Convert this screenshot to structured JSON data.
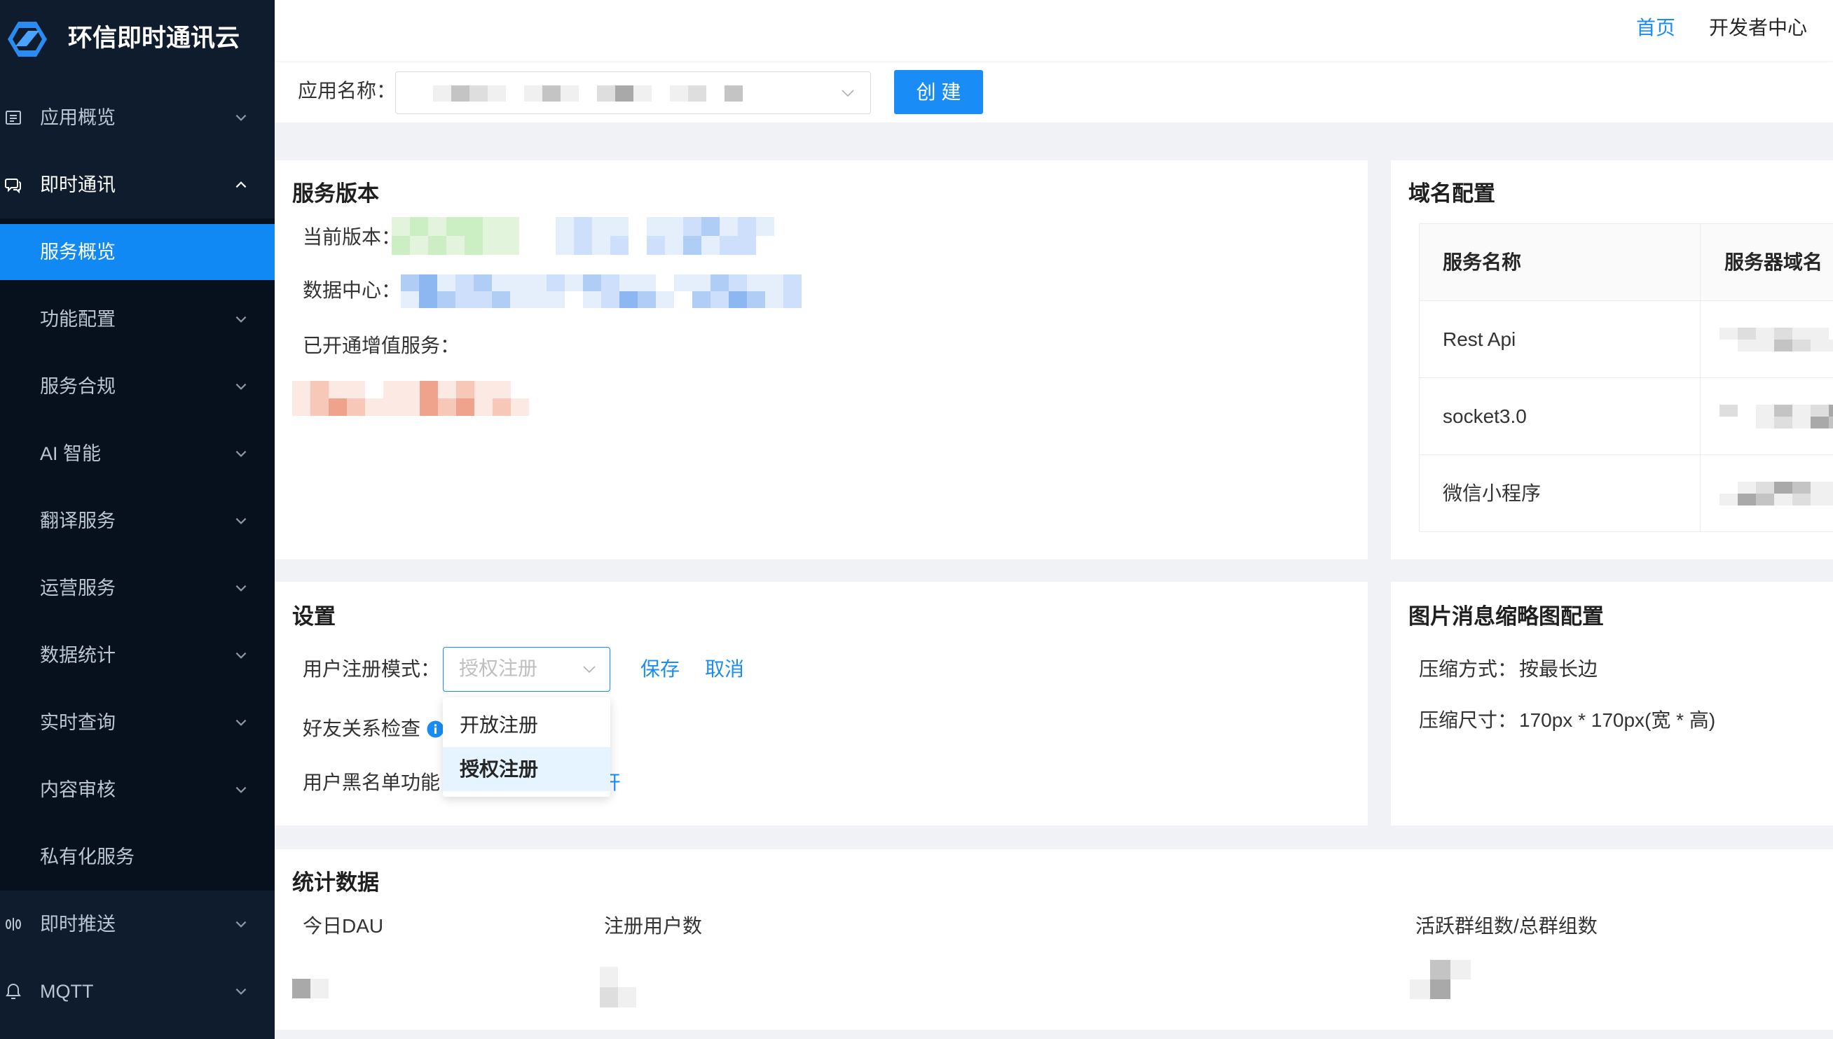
{
  "brand": {
    "name": "环信即时通讯云"
  },
  "colors": {
    "accent": "#1a8cf5",
    "sidebar_bg": "#0f1c2e",
    "submenu_bg": "#07111d",
    "page_bg": "#f0f2f5"
  },
  "header": {
    "home": "首页",
    "developer_center": "开发者中心"
  },
  "app_bar": {
    "label": "应用名称：",
    "create_button": "创 建"
  },
  "sidebar": {
    "items": [
      {
        "label": "应用概览",
        "icon": "list-icon",
        "chevron": "down"
      },
      {
        "label": "即时通讯",
        "icon": "chat-icon",
        "chevron": "up",
        "expanded": true
      },
      {
        "label": "服务概览",
        "active": true
      },
      {
        "label": "功能配置",
        "chevron": "down"
      },
      {
        "label": "服务合规",
        "chevron": "down"
      },
      {
        "label": "AI 智能",
        "chevron": "down"
      },
      {
        "label": "翻译服务",
        "chevron": "down"
      },
      {
        "label": "运营服务",
        "chevron": "down"
      },
      {
        "label": "数据统计",
        "chevron": "down"
      },
      {
        "label": "实时查询",
        "chevron": "down"
      },
      {
        "label": "内容审核",
        "chevron": "down"
      },
      {
        "label": "私有化服务"
      },
      {
        "label": "即时推送",
        "icon": "push-icon",
        "chevron": "down"
      },
      {
        "label": "MQTT",
        "icon": "mqtt-icon",
        "chevron": "down"
      }
    ]
  },
  "service_version": {
    "title": "服务版本",
    "current_version_label": "当前版本：",
    "data_center_label": "数据中心：",
    "value_added_label": "已开通增值服务："
  },
  "domain_config": {
    "title": "域名配置",
    "columns": [
      "服务名称",
      "服务器域名"
    ],
    "rows": [
      {
        "service": "Rest Api"
      },
      {
        "service": "socket3.0"
      },
      {
        "service": "微信小程序"
      }
    ]
  },
  "settings": {
    "title": "设置",
    "registration_mode_label": "用户注册模式：",
    "registration_mode_placeholder": "授权注册",
    "save": "保存",
    "cancel": "取消",
    "friend_check_label": "好友关系检查",
    "blacklist_label": "用户黑名单功能",
    "blacklist_action_partial": "开",
    "dropdown_options": [
      {
        "label": "开放注册"
      },
      {
        "label": "授权注册",
        "selected": true
      }
    ]
  },
  "thumbnail_config": {
    "title": "图片消息缩略图配置",
    "method_label": "压缩方式：",
    "method_value": "按最长边",
    "size_label": "压缩尺寸：",
    "size_value": "170px * 170px(宽 * 高)"
  },
  "statistics": {
    "title": "统计数据",
    "columns": [
      "今日DAU",
      "注册用户数",
      "活跃群组数/总群组数"
    ]
  }
}
